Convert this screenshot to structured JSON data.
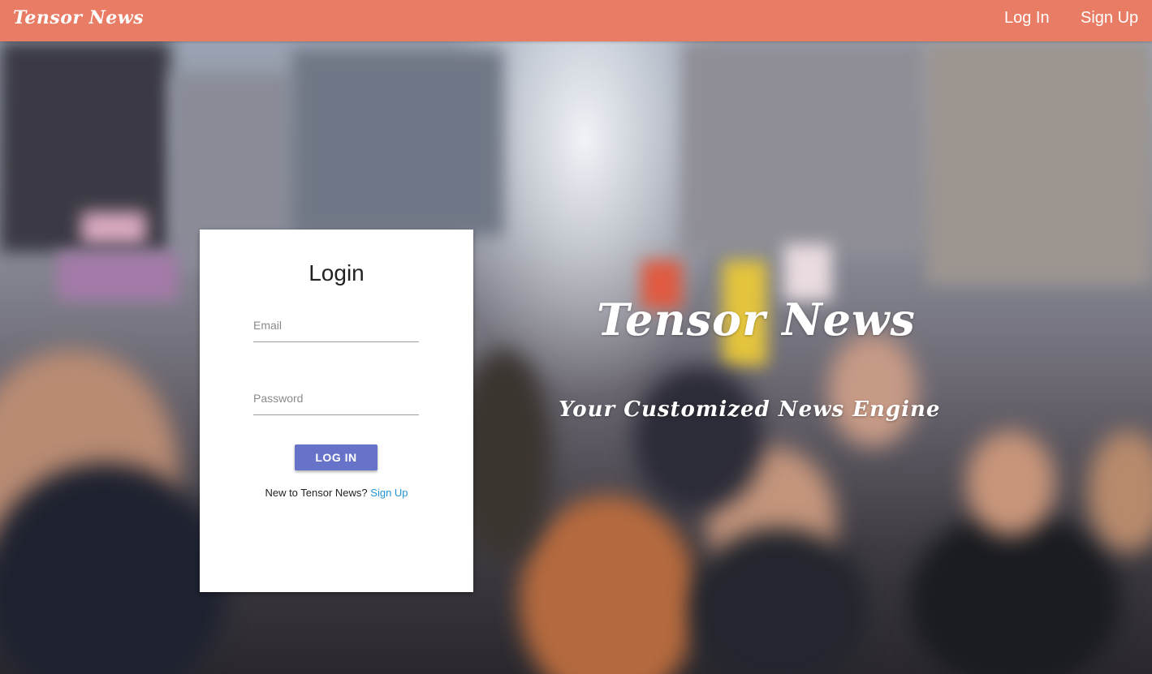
{
  "navbar": {
    "brand": "Tensor News",
    "login_label": "Log In",
    "signup_label": "Sign Up",
    "background_color": "#e87c64"
  },
  "login_card": {
    "title": "Login",
    "email_placeholder": "Email",
    "email_value": "",
    "password_placeholder": "Password",
    "password_value": "",
    "submit_label": "LOG IN",
    "signup_prompt": "New to Tensor News?",
    "signup_link": "Sign Up",
    "button_color": "#6773c9",
    "link_color": "#2196d3"
  },
  "hero": {
    "title": "Tensor News",
    "subtitle": "Your Customized News Engine"
  }
}
